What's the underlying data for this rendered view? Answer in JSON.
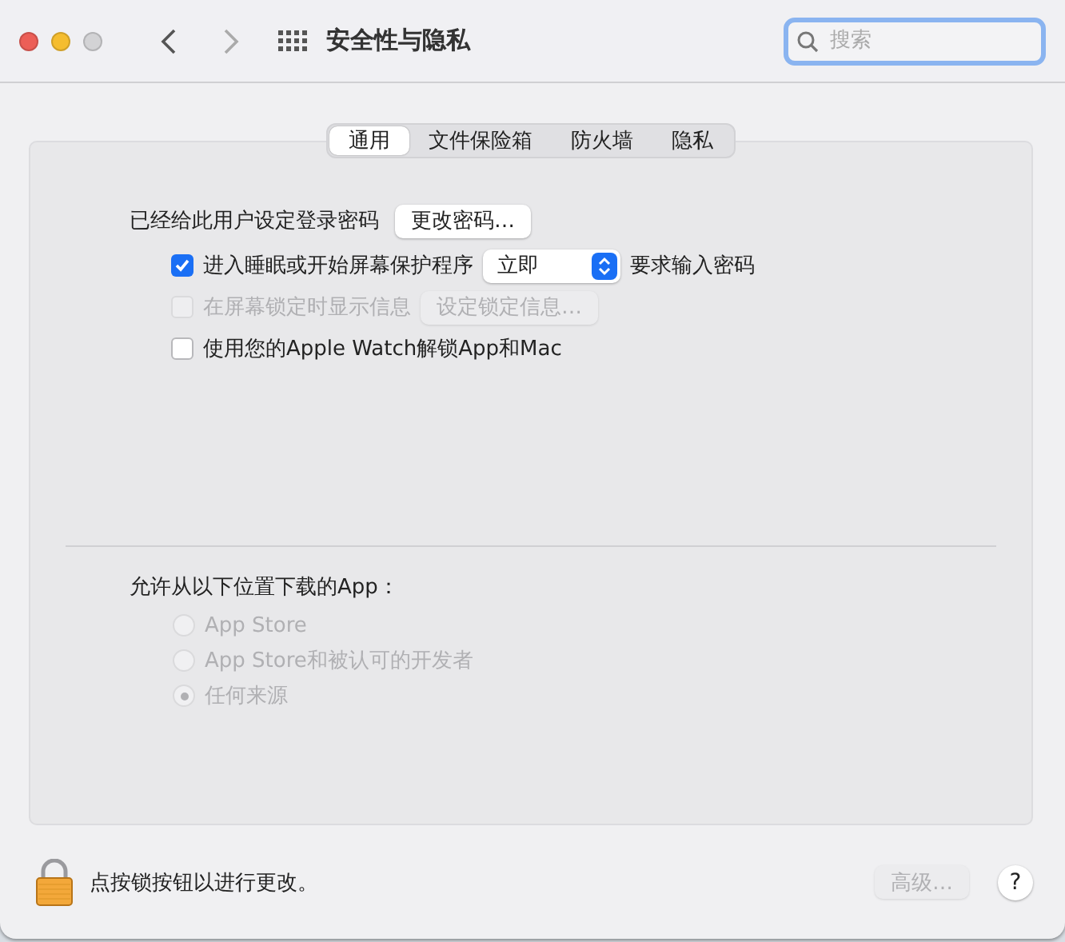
{
  "window": {
    "title": "安全性与隐私",
    "back_enabled": true,
    "forward_enabled": false
  },
  "search": {
    "placeholder": "搜索"
  },
  "tabs": [
    {
      "label": "通用",
      "selected": true
    },
    {
      "label": "文件保险箱",
      "selected": false
    },
    {
      "label": "防火墙",
      "selected": false
    },
    {
      "label": "隐私",
      "selected": false
    }
  ],
  "general": {
    "password_label": "已经给此用户设定登录密码",
    "change_password_button": "更改密码…",
    "options": [
      {
        "kind": "popup",
        "label": "进入睡眠或开始屏幕保护程序",
        "checked": true,
        "disabled": false,
        "popup": "立即",
        "suffix": "要求输入密码"
      },
      {
        "kind": "button",
        "label": "在屏幕锁定时显示信息",
        "checked": false,
        "disabled": true,
        "button": "设定锁定信息…"
      },
      {
        "kind": "plain",
        "label": "使用您的Apple Watch解锁App和Mac",
        "checked": false,
        "disabled": false
      }
    ]
  },
  "downloads": {
    "label": "允许从以下位置下载的App：",
    "options": [
      {
        "label": "App Store",
        "selected": false,
        "disabled": true
      },
      {
        "label": "App Store和被认可的开发者",
        "selected": false,
        "disabled": true
      },
      {
        "label": "任何来源",
        "selected": true,
        "disabled": true
      }
    ]
  },
  "footer": {
    "lock_text": "点按锁按钮以进行更改。",
    "advanced_button": "高级…",
    "advanced_disabled": true,
    "help": "?"
  }
}
